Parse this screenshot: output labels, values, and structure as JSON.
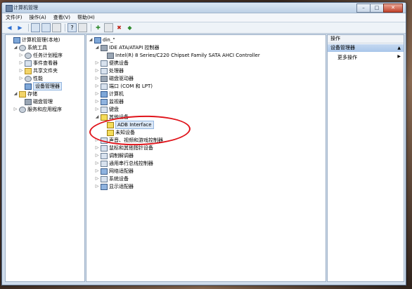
{
  "window": {
    "title": "计算机管理"
  },
  "menu": [
    "文件(F)",
    "操作(A)",
    "查看(V)",
    "帮助(H)"
  ],
  "left_tree": [
    {
      "label": "计算机管理(本地)",
      "indent": 0,
      "tri": "",
      "icon": "computer"
    },
    {
      "label": "系统工具",
      "indent": 1,
      "tri": "◢",
      "icon": "gear"
    },
    {
      "label": "任务计划程序",
      "indent": 2,
      "tri": "▷",
      "icon": "clock"
    },
    {
      "label": "事件查看器",
      "indent": 2,
      "tri": "▷",
      "icon": "event"
    },
    {
      "label": "共享文件夹",
      "indent": 2,
      "tri": "▷",
      "icon": "folder"
    },
    {
      "label": "性能",
      "indent": 2,
      "tri": "▷",
      "icon": "perf"
    },
    {
      "label": "设备管理器",
      "indent": 2,
      "tri": "",
      "icon": "devmgr",
      "selected": true
    },
    {
      "label": "存储",
      "indent": 1,
      "tri": "◢",
      "icon": "storage"
    },
    {
      "label": "磁盘管理",
      "indent": 2,
      "tri": "",
      "icon": "disk"
    },
    {
      "label": "服务和应用程序",
      "indent": 1,
      "tri": "▷",
      "icon": "services"
    }
  ],
  "device_tree": [
    {
      "label": "din_\"",
      "indent": 0,
      "tri": "◢",
      "icon": "computer"
    },
    {
      "label": "IDE ATA/ATAPI 控制器",
      "indent": 1,
      "tri": "◢",
      "icon": "disk"
    },
    {
      "label": "Intel(R) 8 Series/C220 Chipset Family SATA AHCI Controller",
      "indent": 2,
      "tri": "",
      "icon": "disk"
    },
    {
      "label": "便携设备",
      "indent": 1,
      "tri": "▷",
      "icon": "device"
    },
    {
      "label": "处理器",
      "indent": 1,
      "tri": "▷",
      "icon": "device"
    },
    {
      "label": "磁盘驱动器",
      "indent": 1,
      "tri": "▷",
      "icon": "disk"
    },
    {
      "label": "端口 (COM 和 LPT)",
      "indent": 1,
      "tri": "▷",
      "icon": "device"
    },
    {
      "label": "计算机",
      "indent": 1,
      "tri": "▷",
      "icon": "computer"
    },
    {
      "label": "监视器",
      "indent": 1,
      "tri": "▷",
      "icon": "monitor"
    },
    {
      "label": "键盘",
      "indent": 1,
      "tri": "▷",
      "icon": "device"
    },
    {
      "label": "其他设备",
      "indent": 1,
      "tri": "◢",
      "icon": "warn"
    },
    {
      "label": "ADB Interface",
      "indent": 2,
      "tri": "",
      "icon": "warn",
      "selected": true
    },
    {
      "label": "未知设备",
      "indent": 2,
      "tri": "",
      "icon": "warn"
    },
    {
      "label": "声音、视频和游戏控制器",
      "indent": 1,
      "tri": "▷",
      "icon": "device"
    },
    {
      "label": "鼠标和其他指针设备",
      "indent": 1,
      "tri": "▷",
      "icon": "device"
    },
    {
      "label": "调制解调器",
      "indent": 1,
      "tri": "▷",
      "icon": "device"
    },
    {
      "label": "通用串行总线控制器",
      "indent": 1,
      "tri": "▷",
      "icon": "device"
    },
    {
      "label": "网络适配器",
      "indent": 1,
      "tri": "▷",
      "icon": "monitor"
    },
    {
      "label": "系统设备",
      "indent": 1,
      "tri": "▷",
      "icon": "device"
    },
    {
      "label": "显示适配器",
      "indent": 1,
      "tri": "▷",
      "icon": "monitor"
    }
  ],
  "actions_panel": {
    "header": "操作",
    "section": "设备管理器",
    "more": "更多操作"
  }
}
